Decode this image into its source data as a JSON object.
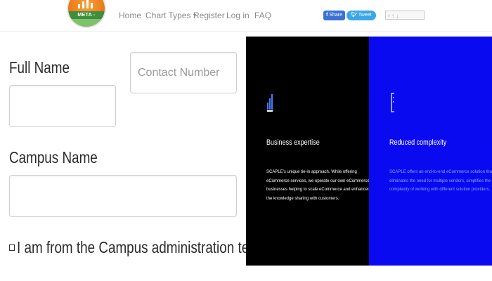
{
  "logo": {
    "text": "META -"
  },
  "nav": {
    "home": "Home",
    "chart_types": "Chart Types",
    "register": "Register",
    "login": "Log in",
    "faq": "FAQ"
  },
  "social": {
    "share": "Share",
    "tweet": "Tweet"
  },
  "form": {
    "full_name_label": "Full Name",
    "contact_placeholder": "Contact Number",
    "campus_label": "Campus Name",
    "admin_checkbox_label": "I am from the Campus administration team"
  },
  "features": [
    {
      "title": "Business expertise",
      "body": "SCAPLE's unique tie-in approach. While offering eCommerce services, we operate our own eCommerce businesses helping to scale eCommerce and enhanced the knowledge sharing with customers.",
      "icon": "bar-chart-icon"
    },
    {
      "title": "Reduced complexity",
      "body": "SCAPLE offers an end-to-end eCommerce solution that eliminates the need for multiple vendors, simplifies the complexity of working with different solution providers.",
      "icon": "bracket-icon"
    }
  ],
  "colors": {
    "panel_left": "#000000",
    "panel_right": "#0a0af0",
    "nav_text": "#8a8a8a",
    "share": "#3b71d6",
    "tweet": "#3aa7e9"
  }
}
